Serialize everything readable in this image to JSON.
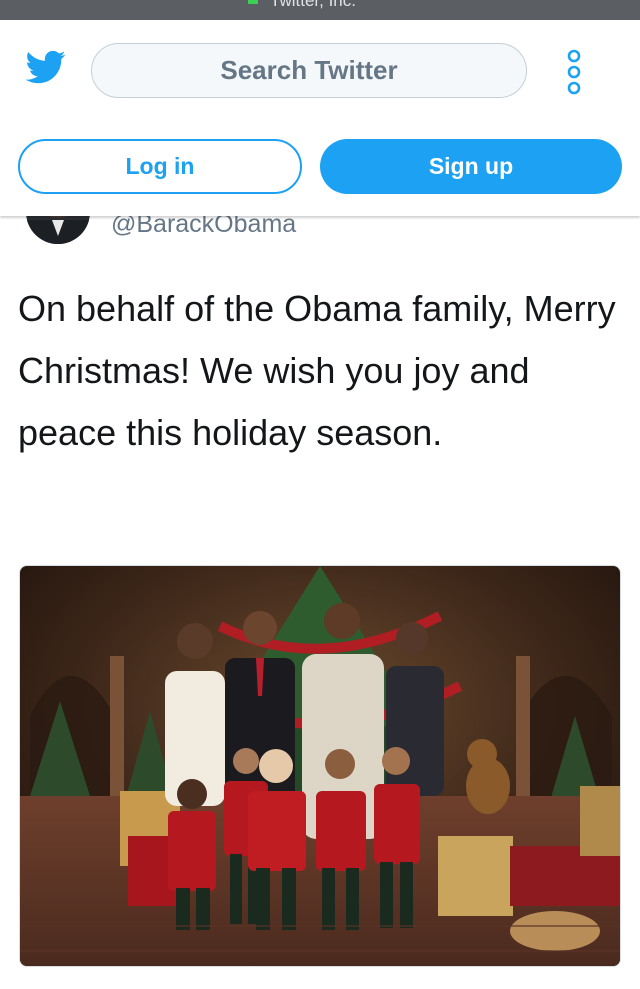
{
  "status_bar": {
    "domain_text": "Twitter, Inc."
  },
  "header": {
    "logo_icon": "twitter-bird-icon",
    "search_placeholder": "Search Twitter",
    "more_icon": "more-options-icon",
    "login_label": "Log in",
    "signup_label": "Sign up"
  },
  "tweet": {
    "handle": "@BarackObama",
    "text": "On behalf of the Obama family, Merry Christmas! We wish you joy and peace this holiday season.",
    "photo_alt": "Obama family photo with children dressed as elves in front of a Christmas tree"
  },
  "colors": {
    "brand_blue": "#1da1f2",
    "text_primary": "#14171a",
    "text_secondary": "#657786",
    "border": "#c4cfd6"
  }
}
